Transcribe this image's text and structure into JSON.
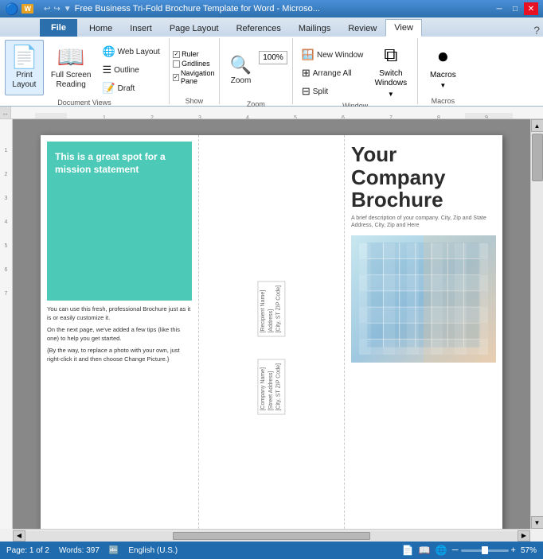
{
  "titlebar": {
    "title": "Free Business Tri-Fold Brochure Template for Word - Microsо...",
    "file_icon": "W",
    "undo_icon": "↩",
    "redo_icon": "↪"
  },
  "tabs": {
    "file_label": "File",
    "items": [
      "Home",
      "Insert",
      "Page Layout",
      "References",
      "Mailings",
      "Review",
      "View"
    ]
  },
  "ribbon": {
    "groups": {
      "doc_views": {
        "label": "Document Views",
        "print_layout": "Print\nLayout",
        "full_screen": "Full Screen\nReading",
        "web_layout": "Web Layout",
        "outline": "Outline",
        "draft": "Draft"
      },
      "show": {
        "label": "Show"
      },
      "zoom": {
        "label": "Zoom",
        "zoom_btn": "Zoom",
        "zoom_pct": "100%"
      },
      "window": {
        "label": "Window",
        "new_window": "New Window",
        "arrange_all": "Arrange All",
        "split": "Split",
        "switch_windows": "Switch\nWindows"
      },
      "macros": {
        "label": "Macros",
        "btn": "Macros"
      }
    }
  },
  "page": {
    "left_col": {
      "teal_heading": "This is a great spot for a mission statement",
      "para1": "You can use this fresh, professional Brochure just as it is or easily customize it.",
      "para2": "On the next page, we've added a few tips (like this one) to help you get started.",
      "para3": "{By the way, to replace a photo with your own, just right-click it and then choose Change Picture.}"
    },
    "mid_col": {
      "address1_line1": "[Recipient Name]",
      "address1_line2": "[Address]",
      "address1_line3": "[City, ST ZIP Code]",
      "address2_line1": "[Company Name]",
      "address2_line2": "[Street Address]",
      "address2_line3": "[City, ST ZIP Code]"
    },
    "right_col": {
      "title_line1": "Your",
      "title_line2": "Company",
      "title_line3": "Brochure",
      "subtitle": "A brief description of your company. City, Zip and State Address, City, Zip and Here"
    }
  },
  "statusbar": {
    "page_info": "Page: 1 of 2",
    "words": "Words: 397",
    "language": "English (U.S.)",
    "zoom_pct": "57%"
  }
}
